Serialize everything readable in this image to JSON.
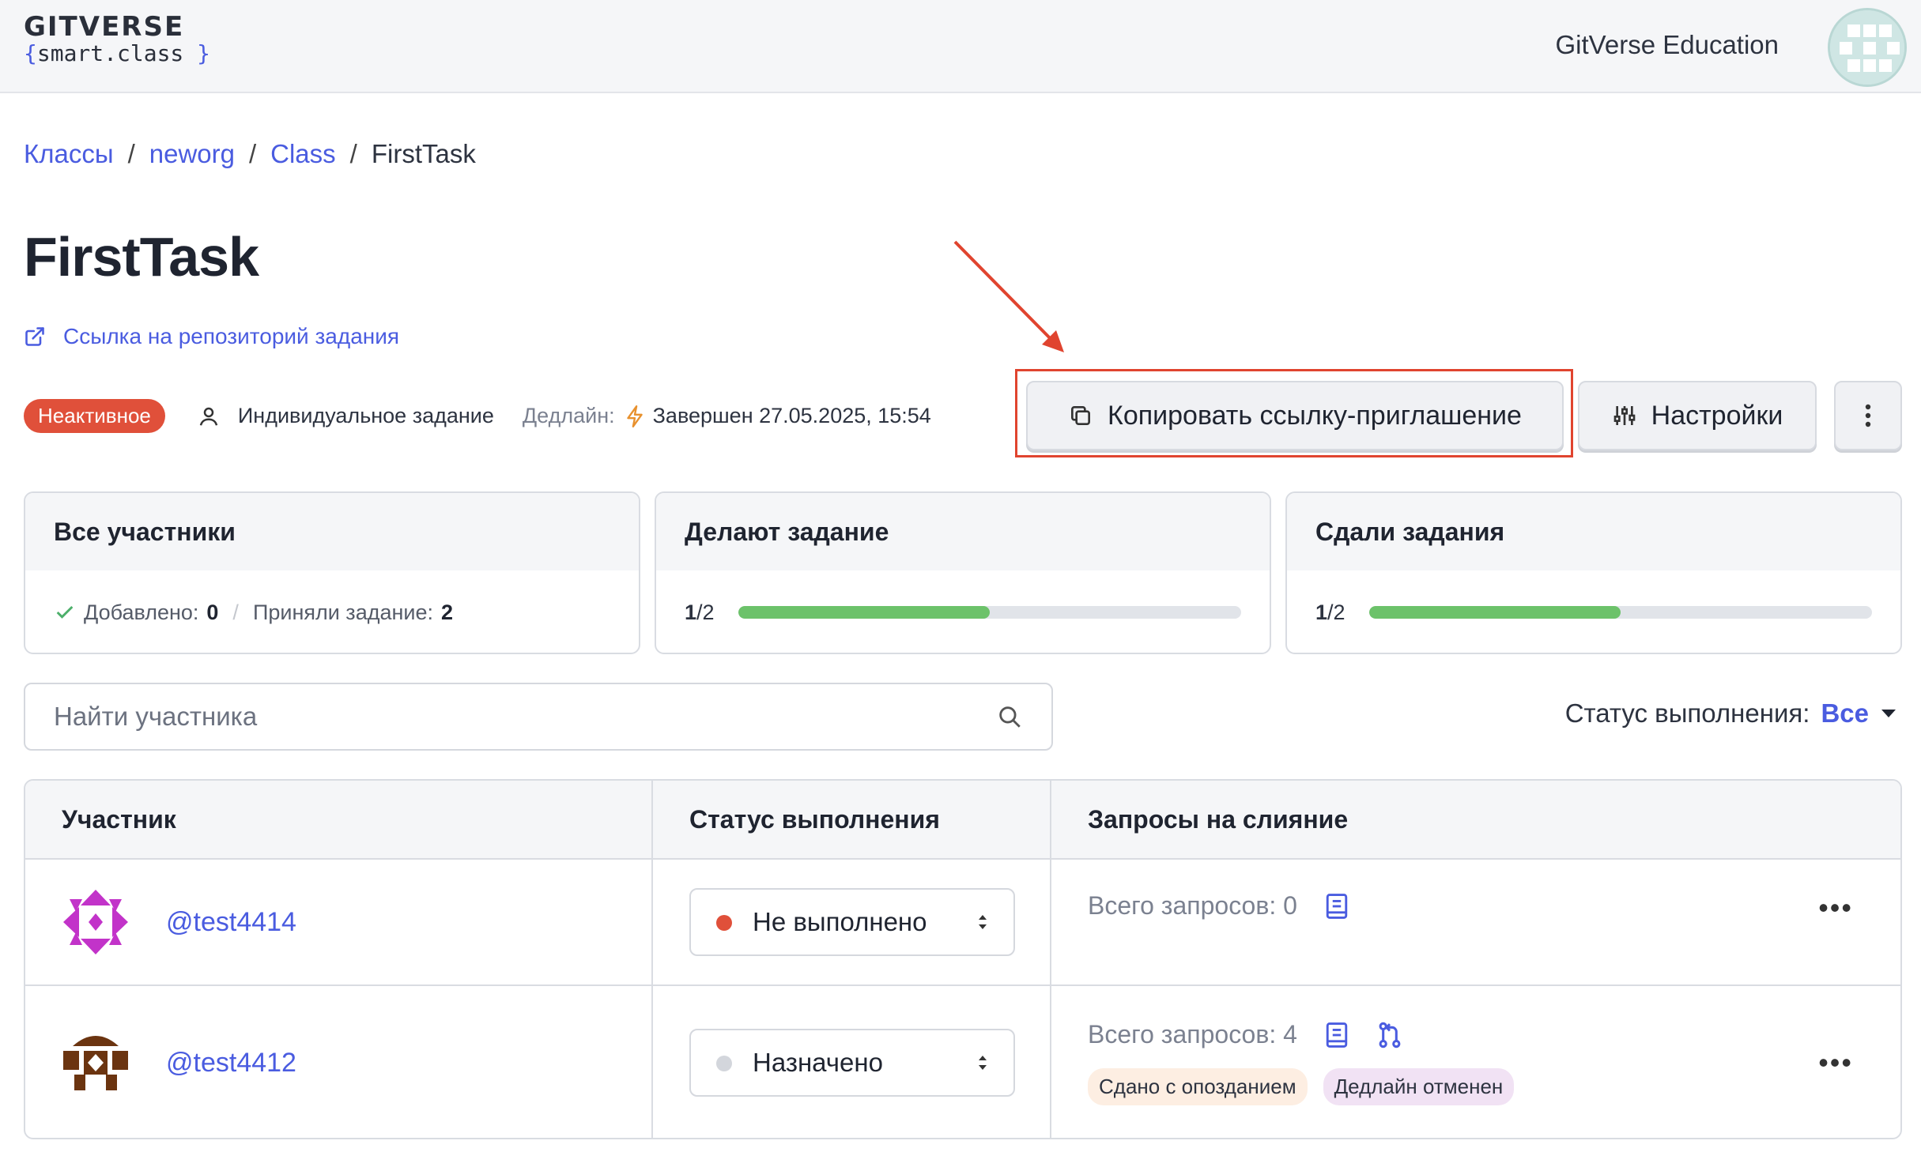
{
  "header": {
    "brand": "GITVERSE",
    "sub_open": "{",
    "sub_text": "smart.class",
    "sub_close": "}",
    "org": "GitVerse Education"
  },
  "breadcrumb": {
    "items": [
      "Классы",
      "neworg",
      "Class"
    ],
    "current": "FirstTask",
    "sep": "/"
  },
  "page": {
    "title": "FirstTask",
    "repo_link": "Ссылка на репозиторий задания"
  },
  "meta": {
    "badge": "Неактивное",
    "type": "Индивидуальное задание",
    "deadline_label": "Дедлайн:",
    "deadline_value": "Завершен 27.05.2025, 15:54"
  },
  "actions": {
    "copy_invite": "Копировать ссылку-приглашение",
    "settings": "Настройки"
  },
  "stats": {
    "all": {
      "title": "Все участники",
      "added_label": "Добавлено:",
      "added_value": "0",
      "accepted_label": "Приняли задание:",
      "accepted_value": "2",
      "divider": "/"
    },
    "doing": {
      "title": "Делают задание",
      "done": "1",
      "sep": "/",
      "total": "2",
      "fraction": 0.5
    },
    "submitted": {
      "title": "Сдали задания",
      "done": "1",
      "sep": "/",
      "total": "2",
      "fraction": 0.5
    }
  },
  "search": {
    "placeholder": "Найти участника"
  },
  "filter": {
    "label": "Статус выполнения:",
    "value": "Все"
  },
  "table": {
    "headers": [
      "Участник",
      "Статус выполнения",
      "Запросы на слияние"
    ],
    "rows": [
      {
        "user": "@test4414",
        "status": "Не выполнено",
        "status_color": "#e0503a",
        "requests": "Всего запросов: 0"
      },
      {
        "user": "@test4412",
        "status": "Назначено",
        "status_color": "#d3d6dc",
        "requests": "Всего запросов: 4",
        "tags": [
          "Сдано с опозданием",
          "Дедлайн отменен"
        ]
      }
    ]
  },
  "colors": {
    "accent": "#4a5ce0",
    "danger": "#e0503a",
    "progress": "#6cc26a"
  }
}
